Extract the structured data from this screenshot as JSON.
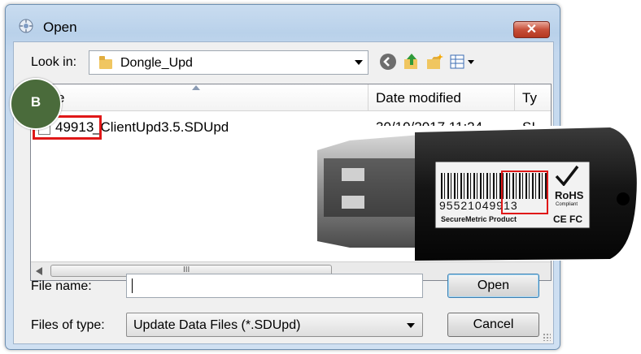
{
  "dialog": {
    "title": "Open",
    "close_glyph": "✕",
    "icons": [
      "dialog-app-icon",
      "close-icon"
    ]
  },
  "toolbar": {
    "look_in_label": "Look in:",
    "look_in_value": "Dongle_Upd",
    "icons": [
      "folder-icon",
      "back-icon",
      "up-folder-icon",
      "new-folder-icon",
      "view-menu-icon"
    ]
  },
  "file_list": {
    "columns": [
      "Name",
      "Date modified",
      "Ty"
    ],
    "visible_name_header": "e",
    "rows": [
      {
        "name_prefix": "49913",
        "name_rest": "_ClientUpd3.5.SDUpd",
        "date_modified": "30/10/2017 11:24 ...",
        "type": "SI"
      }
    ],
    "scroll_thumb_glyph": "III"
  },
  "form": {
    "file_name_label": "File name:",
    "file_name_value": "",
    "files_of_type_label": "Files of type:",
    "files_of_type_value": "Update Data Files (*.SDUpd)",
    "open_button": "Open",
    "cancel_button": "Cancel"
  },
  "annotation": {
    "badge_letter": "B",
    "highlight_color": "#e01818",
    "badge_color": "#4a6b3b"
  },
  "dongle_photo": {
    "label_number": "955210049913",
    "barcode_digits_prefix": "955210",
    "barcode_digits_highlight": "49913",
    "brand_text": "SecureMetric Product",
    "rohs_text": "RoHS",
    "compliant_text": "Compliant",
    "cert_marks": "CE FC"
  }
}
